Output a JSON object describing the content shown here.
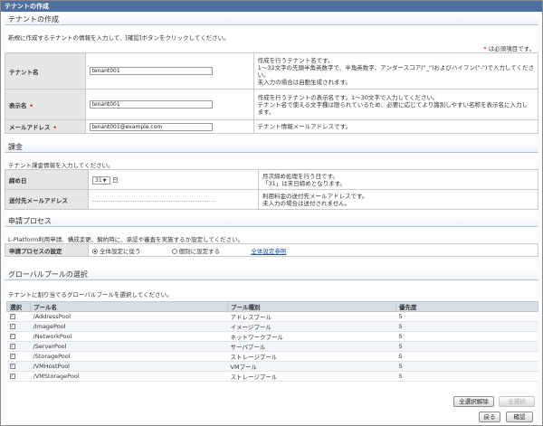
{
  "window": {
    "title": "テナントの作成"
  },
  "tenant_section": {
    "header": "テナントの作成",
    "intro": "新規に作成するテナントの情報を入力して、[確認]ボタンをクリックしてください。",
    "required_note": "* は必須項目です。",
    "rows": [
      {
        "label": "テナント名",
        "value": "tenant001",
        "required": false,
        "desc": [
          "作成を行うテナント名です。",
          "1～32文字の先頭半角英数字で、半角英数字、アンダースコア(\"_\")およびハイフン(\"-\")で入力してくださ",
          "い。",
          "未入力の場合は自動生成されます。"
        ]
      },
      {
        "label": "表示名",
        "value": "tenant001",
        "required": true,
        "desc": [
          "作成を行うテナントの表示名です。1～30文字で入力してください。",
          "テナント名で使える文字種は限られているため、必要に応じてより識別しやすい名称を表示名に入力し",
          "ます。"
        ]
      },
      {
        "label": "メールアドレス",
        "value": "tenant001@example.com",
        "required": true,
        "desc": [
          "テナント情報メールアドレスです。"
        ]
      }
    ]
  },
  "billing_section": {
    "header": "課金",
    "intro": "テナント課金情報を入力してください。",
    "closing_day": {
      "label": "締め日",
      "value": "31",
      "unit": "日",
      "desc": [
        "月次締め処理を行う日です。",
        "「31」は末日締めとなります。"
      ]
    },
    "billing_email": {
      "label": "送付先メールアドレス",
      "value": "",
      "desc": [
        "利用料金の送付先メールアドレスです。",
        "未入力の場合は送付されません。"
      ]
    }
  },
  "request_section": {
    "header": "申請プロセス",
    "intro": "L-Platform利用申請、構成変更、解約時に、承認や審査を実施するか設定してください。",
    "setting": {
      "label": "申請プロセスの設定",
      "option_global": "全体設定に従う",
      "option_individual": "個別に設定する",
      "link": "全体設定参照",
      "selected": "global"
    }
  },
  "pool_section": {
    "header": "グローバルプールの選択",
    "intro": "テナントに割り当てるグローバルプールを選択してください。",
    "columns": [
      "選択",
      "プール名",
      "プール種別",
      "優先度"
    ],
    "rows": [
      {
        "name": "/AddressPool",
        "type": "アドレスプール",
        "priority": "5",
        "checked": true
      },
      {
        "name": "/ImagePool",
        "type": "イメージプール",
        "priority": "5",
        "checked": true
      },
      {
        "name": "/NetworkPool",
        "type": "ネットワークプール",
        "priority": "5",
        "checked": true
      },
      {
        "name": "/ServerPool",
        "type": "サーバプール",
        "priority": "5",
        "checked": true
      },
      {
        "name": "/StoragePool",
        "type": "ストレージプール",
        "priority": "5",
        "checked": true
      },
      {
        "name": "/VMHostPool",
        "type": "VMプール",
        "priority": "5",
        "checked": true
      },
      {
        "name": "/VMStoragePool",
        "type": "ストレージプール",
        "priority": "5",
        "checked": true
      }
    ],
    "btn_clear_all": "全選択解除",
    "btn_select_all": "全選択"
  },
  "footer": {
    "back": "戻る",
    "confirm": "確認"
  }
}
